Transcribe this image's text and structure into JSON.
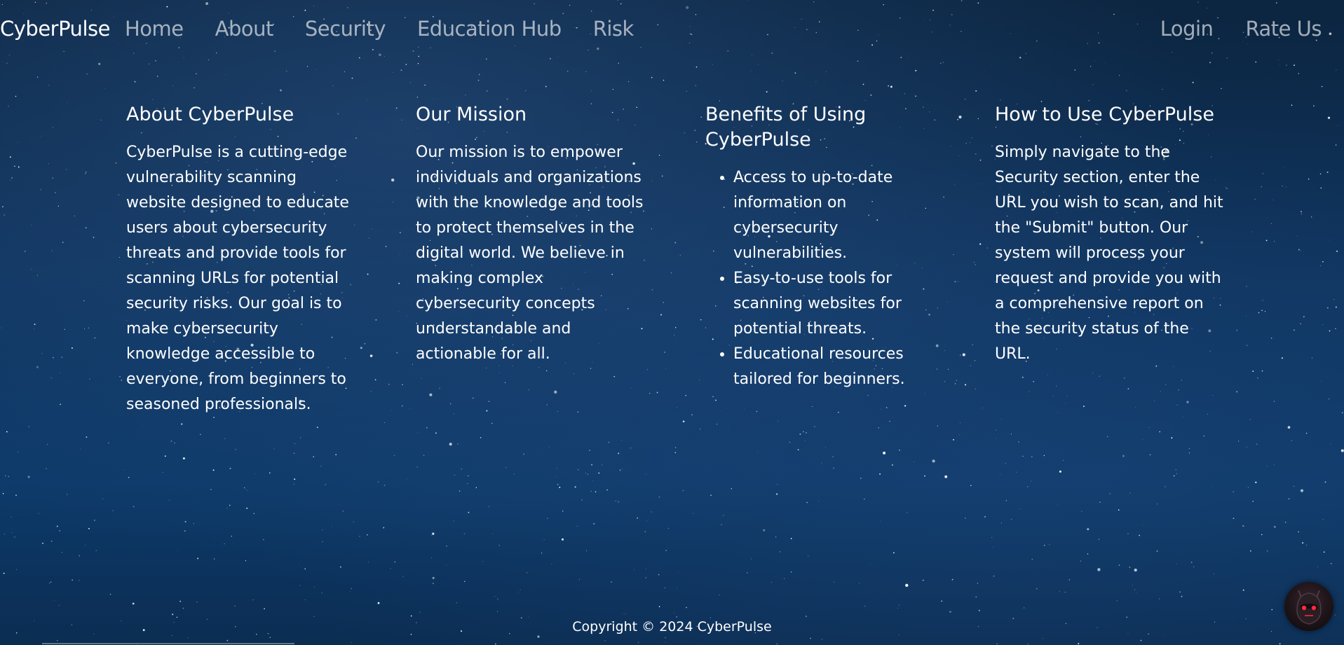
{
  "navbar": {
    "brand": "CyberPulse",
    "links": [
      "Home",
      "About",
      "Security",
      "Education Hub",
      "Risk"
    ],
    "right_links": [
      "Login",
      "Rate Us"
    ]
  },
  "sections": {
    "about": {
      "title": "About CyberPulse",
      "body": "CyberPulse is a cutting-edge vulnerability scanning website designed to educate users about cybersecurity threats and provide tools for scanning URLs for potential security risks. Our goal is to make cybersecurity knowledge accessible to everyone, from beginners to seasoned professionals."
    },
    "mission": {
      "title": "Our Mission",
      "body": "Our mission is to empower individuals and organizations with the knowledge and tools to protect themselves in the digital world. We believe in making complex cybersecurity concepts understandable and actionable for all."
    },
    "benefits": {
      "title": "Benefits of Using CyberPulse",
      "items": [
        "Access to up-to-date information on cybersecurity vulnerabilities.",
        "Easy-to-use tools for scanning websites for potential threats.",
        "Educational resources tailored for beginners."
      ]
    },
    "howto": {
      "title": "How to Use CyberPulse",
      "body": "Simply navigate to the Security section, enter the URL you wish to scan, and hit the \"Submit\" button. Our system will process your request and provide you with a comprehensive report on the security status of the URL."
    }
  },
  "footer": {
    "copyright": "Copyright © 2024 CyberPulse"
  },
  "colors": {
    "background": "#0f3560",
    "text": "#ffffff",
    "nav_link": "#a0a8b4"
  },
  "icons": {
    "avatar": "robot-avatar-icon"
  }
}
